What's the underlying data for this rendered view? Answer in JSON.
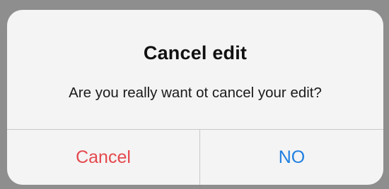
{
  "alert": {
    "title": "Cancel edit",
    "message": "Are you really want ot cancel your edit?",
    "buttons": [
      {
        "label": "Cancel",
        "color": "#e5484d",
        "role": "destructive"
      },
      {
        "label": "NO",
        "color": "#1f7fe0",
        "role": "default"
      }
    ]
  },
  "colors": {
    "backdrop": "#8e8e8e",
    "alert_background": "#f4f4f4",
    "separator": "#c8c8c8"
  }
}
